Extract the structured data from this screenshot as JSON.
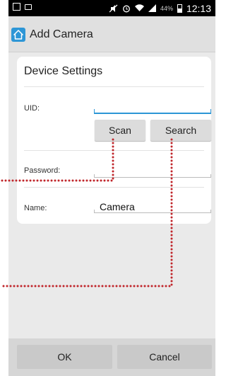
{
  "status_bar": {
    "battery_percent": "44%",
    "time": "12:13",
    "icons": [
      "picture-icon",
      "cast-icon",
      "mute-icon",
      "alarm-icon",
      "wifi-icon",
      "signal-icon",
      "battery-icon"
    ]
  },
  "app_bar": {
    "title": "Add Camera",
    "icon": "home-icon"
  },
  "device_settings": {
    "title": "Device Settings",
    "uid": {
      "label": "UID:",
      "value": ""
    },
    "scan_label": "Scan",
    "search_label": "Search",
    "password": {
      "label": "Password:",
      "value": ""
    },
    "name": {
      "label": "Name:",
      "value": "Camera"
    }
  },
  "footer": {
    "ok_label": "OK",
    "cancel_label": "Cancel"
  },
  "colors": {
    "accent": "#2d96d6",
    "callout": "#c0262b"
  }
}
